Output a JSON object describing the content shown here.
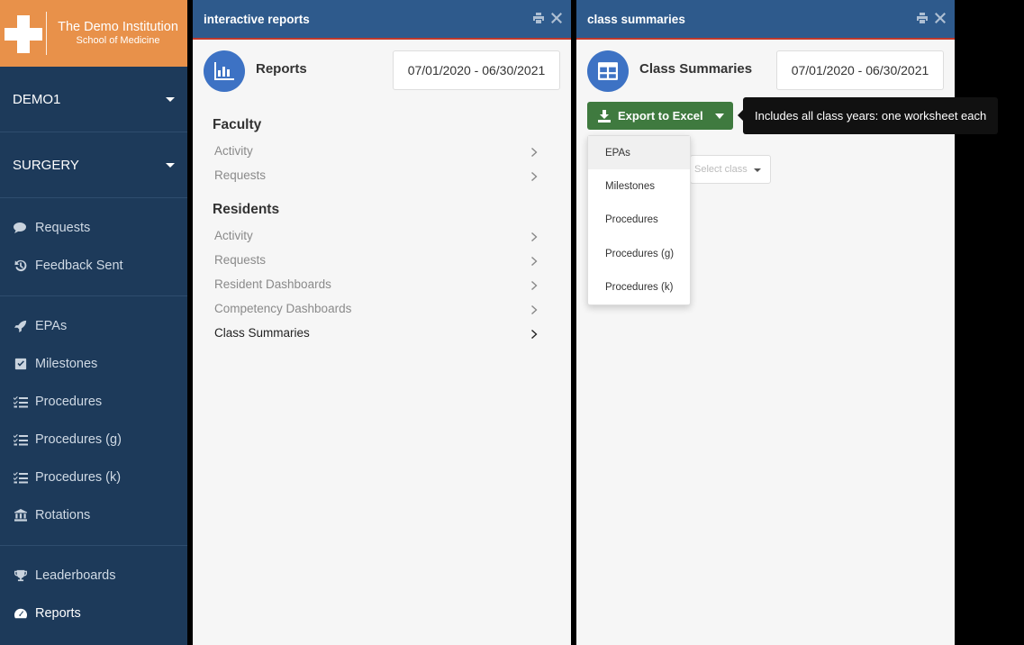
{
  "sidebar": {
    "brand": {
      "line1": "The Demo Institution",
      "line2": "School of Medicine"
    },
    "selectors": [
      {
        "label": "DEMO1"
      },
      {
        "label": "SURGERY"
      }
    ],
    "group1": [
      {
        "label": "Requests",
        "icon": "chat-bubbles-icon"
      },
      {
        "label": "Feedback Sent",
        "icon": "history-icon"
      }
    ],
    "group2": [
      {
        "label": "EPAs",
        "icon": "rocket-icon"
      },
      {
        "label": "Milestones",
        "icon": "check-square-icon"
      },
      {
        "label": "Procedures",
        "icon": "tasks-icon"
      },
      {
        "label": "Procedures (g)",
        "icon": "tasks-icon"
      },
      {
        "label": "Procedures (k)",
        "icon": "tasks-icon"
      },
      {
        "label": "Rotations",
        "icon": "institution-icon"
      }
    ],
    "group3": [
      {
        "label": "Leaderboards",
        "icon": "trophy-icon"
      },
      {
        "label": "Reports",
        "icon": "dashboard-icon"
      }
    ]
  },
  "left_panel": {
    "header": "interactive reports",
    "title": "Reports",
    "date_range": "07/01/2020 - 06/30/2021",
    "faculty": {
      "title": "Faculty",
      "links": [
        "Activity",
        "Requests"
      ]
    },
    "residents": {
      "title": "Residents",
      "links": [
        "Activity",
        "Requests",
        "Resident Dashboards",
        "Competency Dashboards",
        "Class Summaries"
      ]
    }
  },
  "right_panel": {
    "header": "class summaries",
    "title": "Class Summaries",
    "date_range": "07/01/2020 - 06/30/2021",
    "export_label": "Export to Excel",
    "tooltip": "Includes all class years: one worksheet each",
    "menu": [
      "EPAs",
      "Milestones",
      "Procedures",
      "Procedures (g)",
      "Procedures (k)"
    ],
    "select_placeholder": "Select class"
  },
  "colors": {
    "sidebar": "#1d3a5a",
    "brand": "#e8914a",
    "panel_header": "#2e5a8c",
    "header_border": "#c0392b",
    "export_button": "#3f7a3f",
    "icon_circle": "#3d72c4"
  }
}
